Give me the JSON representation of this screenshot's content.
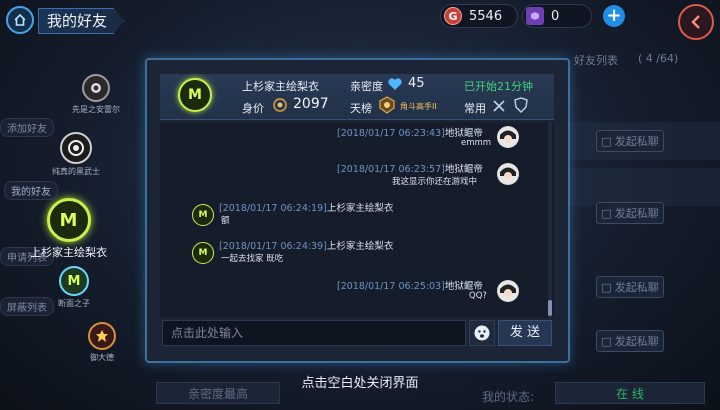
{
  "header": {
    "title": "我的好友",
    "gold": {
      "icon": "G",
      "value": "5546"
    },
    "gem": {
      "value": "0"
    }
  },
  "friends": [
    {
      "name": "先是之安雷尔"
    },
    {
      "name": "纯真的黑武士"
    },
    {
      "name": "上杉家主绘梨衣"
    },
    {
      "name": "断面之子"
    },
    {
      "name": "御大德"
    }
  ],
  "side_tags": {
    "add_friend": "添加好友",
    "my_friends": "我的好友",
    "requests": "申请列表",
    "blocked": "屏蔽列表"
  },
  "background_panel": {
    "friend_list_label": "好友列表",
    "friend_count": "( 4 /64)",
    "private_chat_label": "发起私聊",
    "sort_label": "亲密度最高",
    "my_status_label": "我的状态:",
    "status_value": "在 线"
  },
  "chat_header": {
    "name": "上杉家主绘梨衣",
    "intimacy_label": "亲密度",
    "intimacy_value": "45",
    "status_text": "已开始21分钟",
    "worth_label": "身价",
    "worth_value": "2097",
    "rank_label": "天榜",
    "rank_title": "角斗高手II",
    "common_label": "常用"
  },
  "messages": [
    {
      "side": "right",
      "timestamp": "[2018/01/17    06:23:43]",
      "sender": "地狱鲲帝",
      "text": "emmm"
    },
    {
      "side": "right",
      "timestamp": "[2018/01/17    06:23:57]",
      "sender": "地狱鲲帝",
      "text": "我这显示你还在游戏中"
    },
    {
      "side": "left",
      "timestamp": "[2018/01/17    06:24:19]",
      "sender": "上杉家主绘梨衣",
      "text": "额"
    },
    {
      "side": "left",
      "timestamp": "[2018/01/17    06:24:39]",
      "sender": "上杉家主绘梨衣",
      "text": "一起去找家 既吃"
    },
    {
      "side": "right",
      "timestamp": "[2018/01/17    06:25:03]",
      "sender": "地狱鲲帝",
      "text": "QQ?"
    }
  ],
  "input": {
    "placeholder": "点击此处输入",
    "send_label": "发 送"
  },
  "close_hint": "点击空白处关闭界面",
  "colors": {
    "accent_blue": "#4aa3e8",
    "timestamp_blue": "#6f93c4",
    "online_green": "#2fb36a",
    "back_red": "#e05a4a"
  }
}
